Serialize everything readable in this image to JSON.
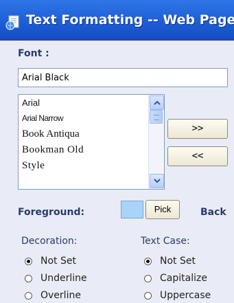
{
  "window": {
    "title": "Text Formatting -- Web Page"
  },
  "font": {
    "label": "Font :",
    "value": "Arial Black",
    "options": [
      "Arial",
      "Arial Narrow",
      "Book Antiqua",
      "Bookman Old",
      "Style"
    ],
    "add_label": ">>",
    "remove_label": "<<"
  },
  "colors": {
    "foreground_label": "Foreground:",
    "foreground_swatch": "#a9d3f7",
    "pick_label": "Pick",
    "background_label": "Back"
  },
  "decoration": {
    "title": "Decoration:",
    "options": [
      {
        "label": "Not Set",
        "checked": true
      },
      {
        "label": "Underline",
        "checked": false
      },
      {
        "label": "Overline",
        "checked": false
      }
    ]
  },
  "text_case": {
    "title": "Text Case:",
    "options": [
      {
        "label": "Not Set",
        "checked": true
      },
      {
        "label": "Capitalize",
        "checked": false
      },
      {
        "label": "Uppercase",
        "checked": false
      }
    ]
  },
  "icons": {
    "title": "web-page-icon",
    "scroll_up": "chevron-up-icon",
    "scroll_down": "chevron-down-icon"
  }
}
